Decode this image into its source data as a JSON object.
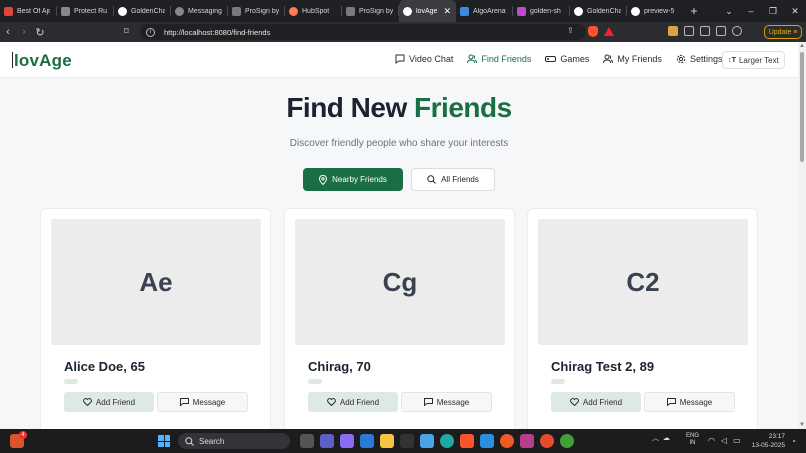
{
  "browser": {
    "tabs": [
      {
        "title": "Best Of Ajr",
        "color": "#e0443b"
      },
      {
        "title": "Protect Ru",
        "color": "#888888"
      },
      {
        "title": "GoldenCha",
        "color": "#ffffff"
      },
      {
        "title": "Messaging",
        "color": "#888888"
      },
      {
        "title": "ProSign by",
        "color": "#7a7a7a"
      },
      {
        "title": "HubSpot",
        "color": "#ff7a59"
      },
      {
        "title": "ProSign by",
        "color": "#7a7a7a"
      },
      {
        "title": "lovAge",
        "color": "#ffffff",
        "active": true
      },
      {
        "title": "AlgoArena",
        "color": "#3a8dde"
      },
      {
        "title": "golden-sh",
        "color": "#c04bd0"
      },
      {
        "title": "GoldenCha",
        "color": "#ffffff"
      },
      {
        "title": "preview-5",
        "color": "#ffffff"
      }
    ],
    "new_tab": "+",
    "url": "http://localhost:8080/find-friends",
    "update_label": "Update"
  },
  "app": {
    "logo": "lovAge",
    "nav": [
      {
        "label": "Video Chat",
        "icon": "chat-icon"
      },
      {
        "label": "Find Friends",
        "icon": "users-icon",
        "active": true
      },
      {
        "label": "Games",
        "icon": "gamepad-icon"
      },
      {
        "label": "My Friends",
        "icon": "users-icon"
      },
      {
        "label": "Settings",
        "icon": "gear-icon"
      }
    ],
    "larger_text_label": "Larger Text",
    "larger_text_prefix": "↕T",
    "heading_part1": "Find New",
    "heading_part2": "Friends",
    "subheading": "Discover friendly people who share your interests",
    "filters": {
      "nearby": "Nearby Friends",
      "all": "All Friends"
    },
    "accent_color": "#1a6e43",
    "cards": [
      {
        "initials": "Ae",
        "name": "Alice Doe, 65",
        "add_label": "Add Friend",
        "message_label": "Message"
      },
      {
        "initials": "Cg",
        "name": "Chirag, 70",
        "add_label": "Add Friend",
        "message_label": "Message"
      },
      {
        "initials": "C2",
        "name": "Chirag Test 2, 89",
        "add_label": "Add Friend",
        "message_label": "Message"
      }
    ]
  },
  "taskbar": {
    "search_placeholder": "Search",
    "weather_badge": "4",
    "lang_line1": "ENG",
    "lang_line2": "IN",
    "time": "23:17",
    "date": "13-05-2025"
  }
}
